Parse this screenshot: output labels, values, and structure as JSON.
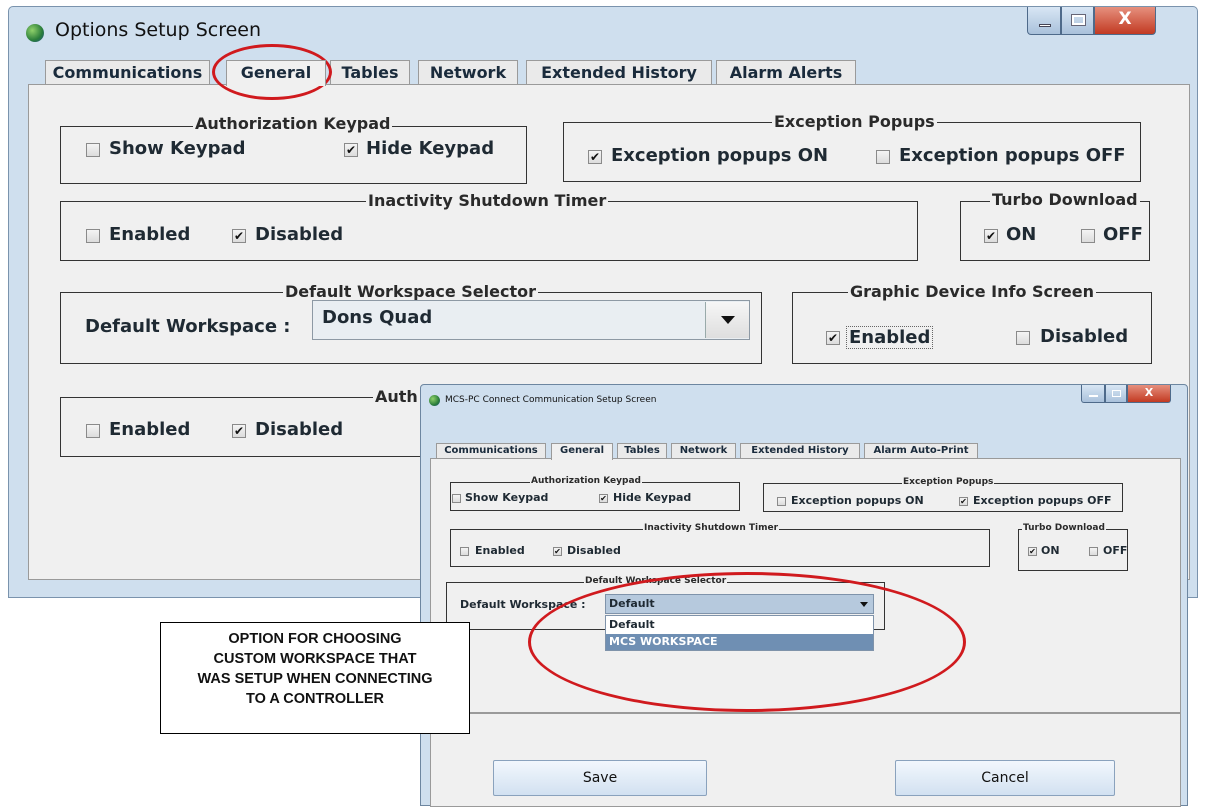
{
  "main_window": {
    "title": "Options Setup Screen",
    "controls": {
      "close": "X"
    },
    "tabs": [
      "Communications",
      "General",
      "Tables",
      "Network",
      "Extended History",
      "Alarm Alerts"
    ],
    "selected_tab": "General",
    "auth_keypad": {
      "title": "Authorization Keypad",
      "show": "Show Keypad",
      "hide": "Hide Keypad"
    },
    "exception_popups": {
      "title": "Exception Popups",
      "on": "Exception popups ON",
      "off": "Exception popups OFF"
    },
    "inactivity": {
      "title": "Inactivity Shutdown Timer",
      "enabled": "Enabled",
      "disabled": "Disabled"
    },
    "turbo": {
      "title": "Turbo Download",
      "on": "ON",
      "off": "OFF"
    },
    "workspace": {
      "title": "Default Workspace Selector",
      "label": "Default Workspace :",
      "value": "Dons Quad"
    },
    "graphic_info": {
      "title": "Graphic Device Info Screen",
      "enabled": "Enabled",
      "disabled": "Disabled"
    },
    "auth_partial": {
      "title": "Auth",
      "enabled": "Enabled",
      "disabled": "Disabled"
    }
  },
  "popup_window": {
    "title": "MCS-PC Connect Communication Setup Screen",
    "tabs": [
      "Communications",
      "General",
      "Tables",
      "Network",
      "Extended History",
      "Alarm Auto-Print"
    ],
    "selected_tab": "General",
    "auth_keypad": {
      "title": "Authorization Keypad",
      "show": "Show Keypad",
      "hide": "Hide Keypad"
    },
    "exception_popups": {
      "title": "Exception Popups",
      "on": "Exception popups ON",
      "off": "Exception popups OFF"
    },
    "inactivity": {
      "title": "Inactivity Shutdown Timer",
      "enabled": "Enabled",
      "disabled": "Disabled"
    },
    "turbo": {
      "title": "Turbo Download",
      "on": "ON",
      "off": "OFF"
    },
    "workspace": {
      "title": "Default Workspace Selector",
      "label": "Default Workspace :",
      "value": "Default",
      "options": [
        "Default",
        "MCS WORKSPACE"
      ],
      "highlighted_option": "MCS WORKSPACE"
    },
    "save_label": "Save",
    "cancel_label": "Cancel"
  },
  "callout": {
    "lines": [
      "OPTION FOR CHOOSING",
      "CUSTOM WORKSPACE THAT",
      "WAS SETUP WHEN CONNECTING",
      "TO A CONTROLLER"
    ]
  },
  "colors": {
    "highlight_ring": "#d01a1e",
    "dropdown_highlight": "#6f8fb3",
    "title_bar": "#cfdfee"
  }
}
